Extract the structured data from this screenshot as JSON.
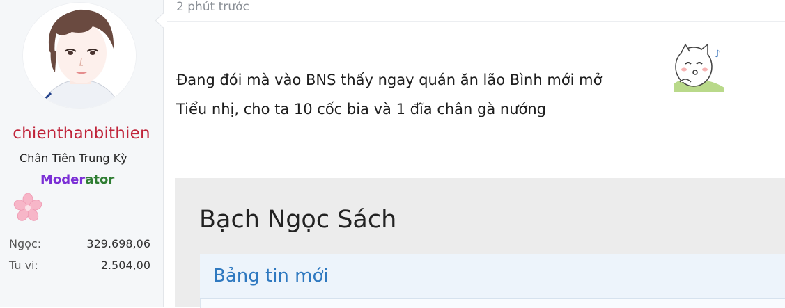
{
  "post": {
    "time": "2 phút trước",
    "lines": [
      "Đang đói mà vào BNS thấy ngay quán ăn lão Bình mới mở",
      "Tiểu nhị, cho ta 10 cốc bia và 1 đĩa chân gà nướng"
    ]
  },
  "user": {
    "name": "chienthanbithien",
    "title": "Chân Tiên Trung Kỳ",
    "role_part1": "Moder",
    "role_part2": "ator",
    "stats": [
      {
        "label": "Ngọc:",
        "value": "329.698,06"
      },
      {
        "label": "Tu vi:",
        "value": "2.504,00"
      }
    ]
  },
  "embed": {
    "title": "Bạch Ngọc Sách",
    "section_title": "Bảng tin mới"
  },
  "colors": {
    "username": "#c0243a",
    "role_purple": "#7b2fd6",
    "role_green": "#2e7d32",
    "link_blue": "#2f79c0"
  }
}
